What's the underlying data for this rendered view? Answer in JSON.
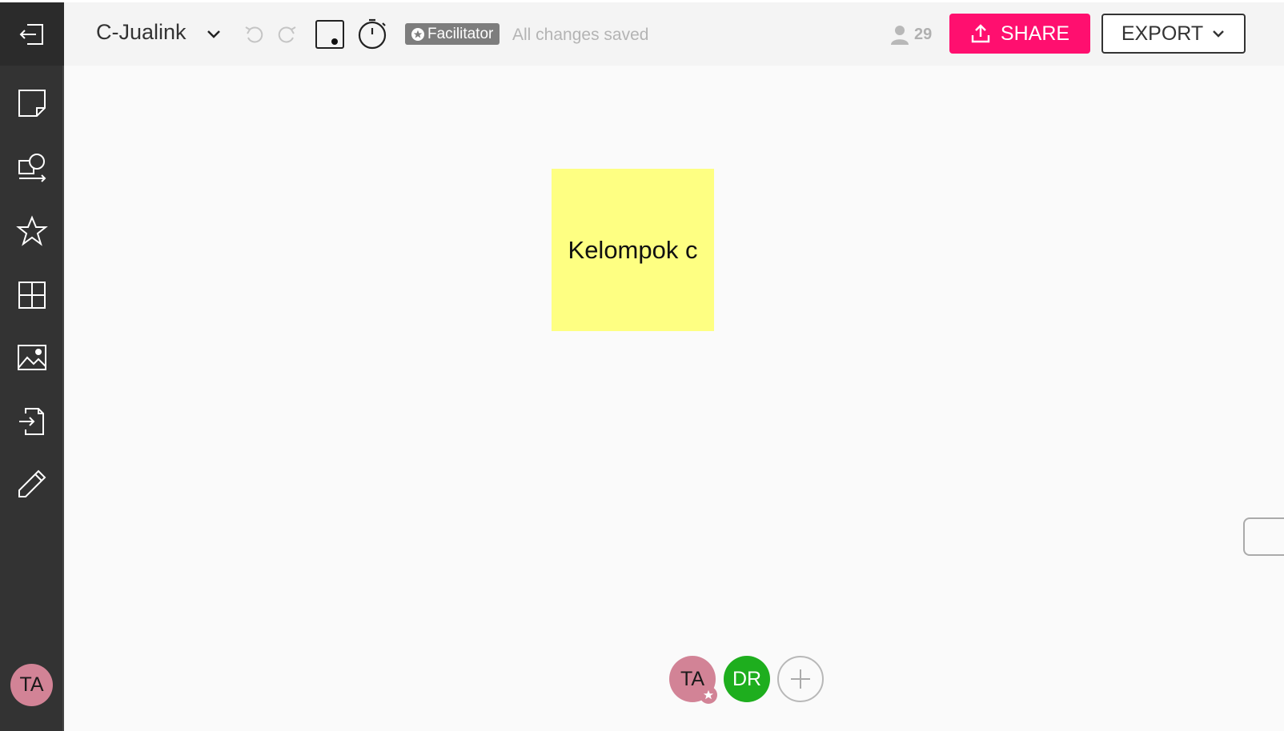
{
  "header": {
    "board_title": "C-Jualink",
    "facilitator_label": "Facilitator",
    "save_status": "All changes saved",
    "participants_count": "29",
    "share_label": "SHARE",
    "export_label": "EXPORT"
  },
  "sidebar": {
    "items": [
      {
        "icon": "sticky-note-icon"
      },
      {
        "icon": "shapes-icon"
      },
      {
        "icon": "star-icon"
      },
      {
        "icon": "grid-icon"
      },
      {
        "icon": "image-icon"
      },
      {
        "icon": "import-icon"
      },
      {
        "icon": "pencil-icon"
      }
    ],
    "user_initials": "TA"
  },
  "canvas": {
    "sticky_note_text": "Kelompok c",
    "sticky_note_color": "#feff82"
  },
  "collaborators": [
    {
      "initials": "TA",
      "color": "#d28396"
    },
    {
      "initials": "DR",
      "color": "#1eae1e"
    }
  ],
  "colors": {
    "share_accent": "#ff0f6f",
    "sidebar_bg": "#333333"
  }
}
